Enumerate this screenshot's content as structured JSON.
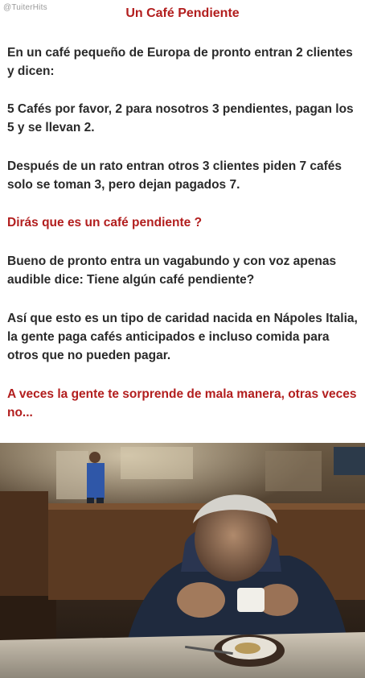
{
  "watermark": "@TuiterHits",
  "title": "Un Café Pendiente",
  "paragraphs": {
    "p1": "En un café pequeño de Europa de pronto entran 2 clientes y dicen:",
    "p2": "5 Cafés por favor, 2 para nosotros 3 pendientes, pagan los 5 y se llevan 2.",
    "p3": "Después de un rato entran otros 3 clientes piden 7 cafés solo se toman 3, pero dejan pagados 7.",
    "p4": "Dirás que es un café pendiente ?",
    "p5": "Bueno de pronto entra un vagabundo y con voz apenas audible dice: Tiene algún café pendiente?",
    "p6": "Así que esto es  un tipo de caridad nacida en Nápoles Italia, la gente paga cafés anticipados e incluso comida para otros que no pueden pagar.",
    "p7": "A veces la gente te sorprende de mala manera, otras veces no..."
  },
  "colors": {
    "accent_red": "#b21e1e",
    "body_text": "#2a2a2a"
  }
}
